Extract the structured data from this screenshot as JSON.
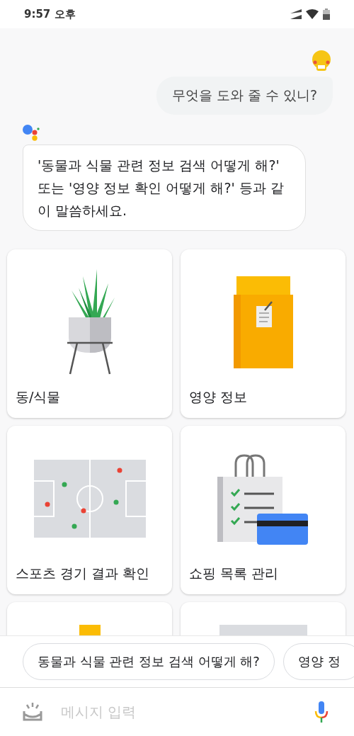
{
  "status_bar": {
    "time": "9:57 오후"
  },
  "user_message": {
    "text": "무엇을 도와 줄 수 있니?"
  },
  "assistant_message": {
    "text": "'동물과 식물 관련 정보 검색 어떻게 해?' 또는 '영양 정보 확인 어떻게 해?' 등과 같이 말씀하세요."
  },
  "cards": [
    {
      "kind": "plant",
      "label": "동/식물"
    },
    {
      "kind": "food-bag",
      "label": "영양 정보"
    },
    {
      "kind": "soccer-field",
      "label": "스포츠 경기 결과 확인"
    },
    {
      "kind": "shopping",
      "label": "쇼핑 목록 관리"
    },
    {
      "kind": "partial-block"
    },
    {
      "kind": "partial-board"
    }
  ],
  "suggestions": [
    "동물과 식물 관련 정보 검색 어떻게 해?",
    "영양 정"
  ],
  "input": {
    "placeholder": "메시지 입력"
  }
}
